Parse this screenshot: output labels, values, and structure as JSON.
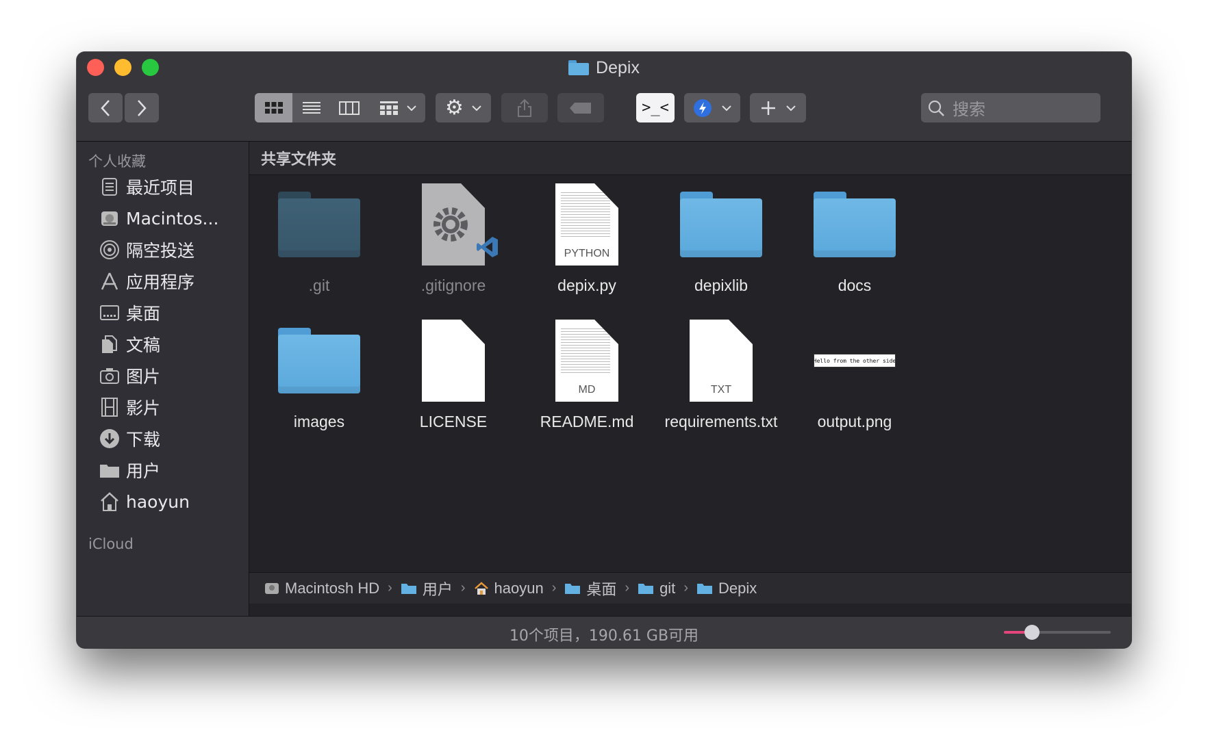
{
  "window": {
    "title": "Depix"
  },
  "toolbar": {
    "search_placeholder": "搜索",
    "terminal_label": ">_<"
  },
  "sidebar": {
    "favorites_header": "个人收藏",
    "icloud_header": "iCloud",
    "items": [
      {
        "label": "最近项目",
        "icon": "recents-icon"
      },
      {
        "label": "Macintos...",
        "icon": "hard-drive-icon"
      },
      {
        "label": "隔空投送",
        "icon": "airdrop-icon"
      },
      {
        "label": "应用程序",
        "icon": "applications-icon"
      },
      {
        "label": "桌面",
        "icon": "desktop-icon"
      },
      {
        "label": "文稿",
        "icon": "documents-icon"
      },
      {
        "label": "图片",
        "icon": "camera-icon"
      },
      {
        "label": "影片",
        "icon": "film-icon"
      },
      {
        "label": "下载",
        "icon": "download-icon"
      },
      {
        "label": "用户",
        "icon": "folder-icon"
      },
      {
        "label": "haoyun",
        "icon": "home-icon"
      }
    ]
  },
  "content": {
    "header": "共享文件夹",
    "files": [
      {
        "name": ".git",
        "kind": "folder",
        "hidden": true
      },
      {
        "name": ".gitignore",
        "kind": "vscode-doc",
        "hidden": true
      },
      {
        "name": "depix.py",
        "kind": "doc",
        "ext": "PYTHON"
      },
      {
        "name": "depixlib",
        "kind": "folder"
      },
      {
        "name": "docs",
        "kind": "folder"
      },
      {
        "name": "images",
        "kind": "folder"
      },
      {
        "name": "LICENSE",
        "kind": "blank-doc"
      },
      {
        "name": "README.md",
        "kind": "doc",
        "ext": "MD"
      },
      {
        "name": "requirements.txt",
        "kind": "doc",
        "ext": "TXT"
      },
      {
        "name": "output.png",
        "kind": "image",
        "thumb_text": "Hello from the other side"
      }
    ]
  },
  "pathbar": [
    "Macintosh HD",
    "用户",
    "haoyun",
    "桌面",
    "git",
    "Depix"
  ],
  "status": {
    "text": "10个项目，190.61 GB可用",
    "icon_size_level": 0.26
  },
  "colors": {
    "accent": "#e4457a",
    "folder": "#63b1e3"
  }
}
